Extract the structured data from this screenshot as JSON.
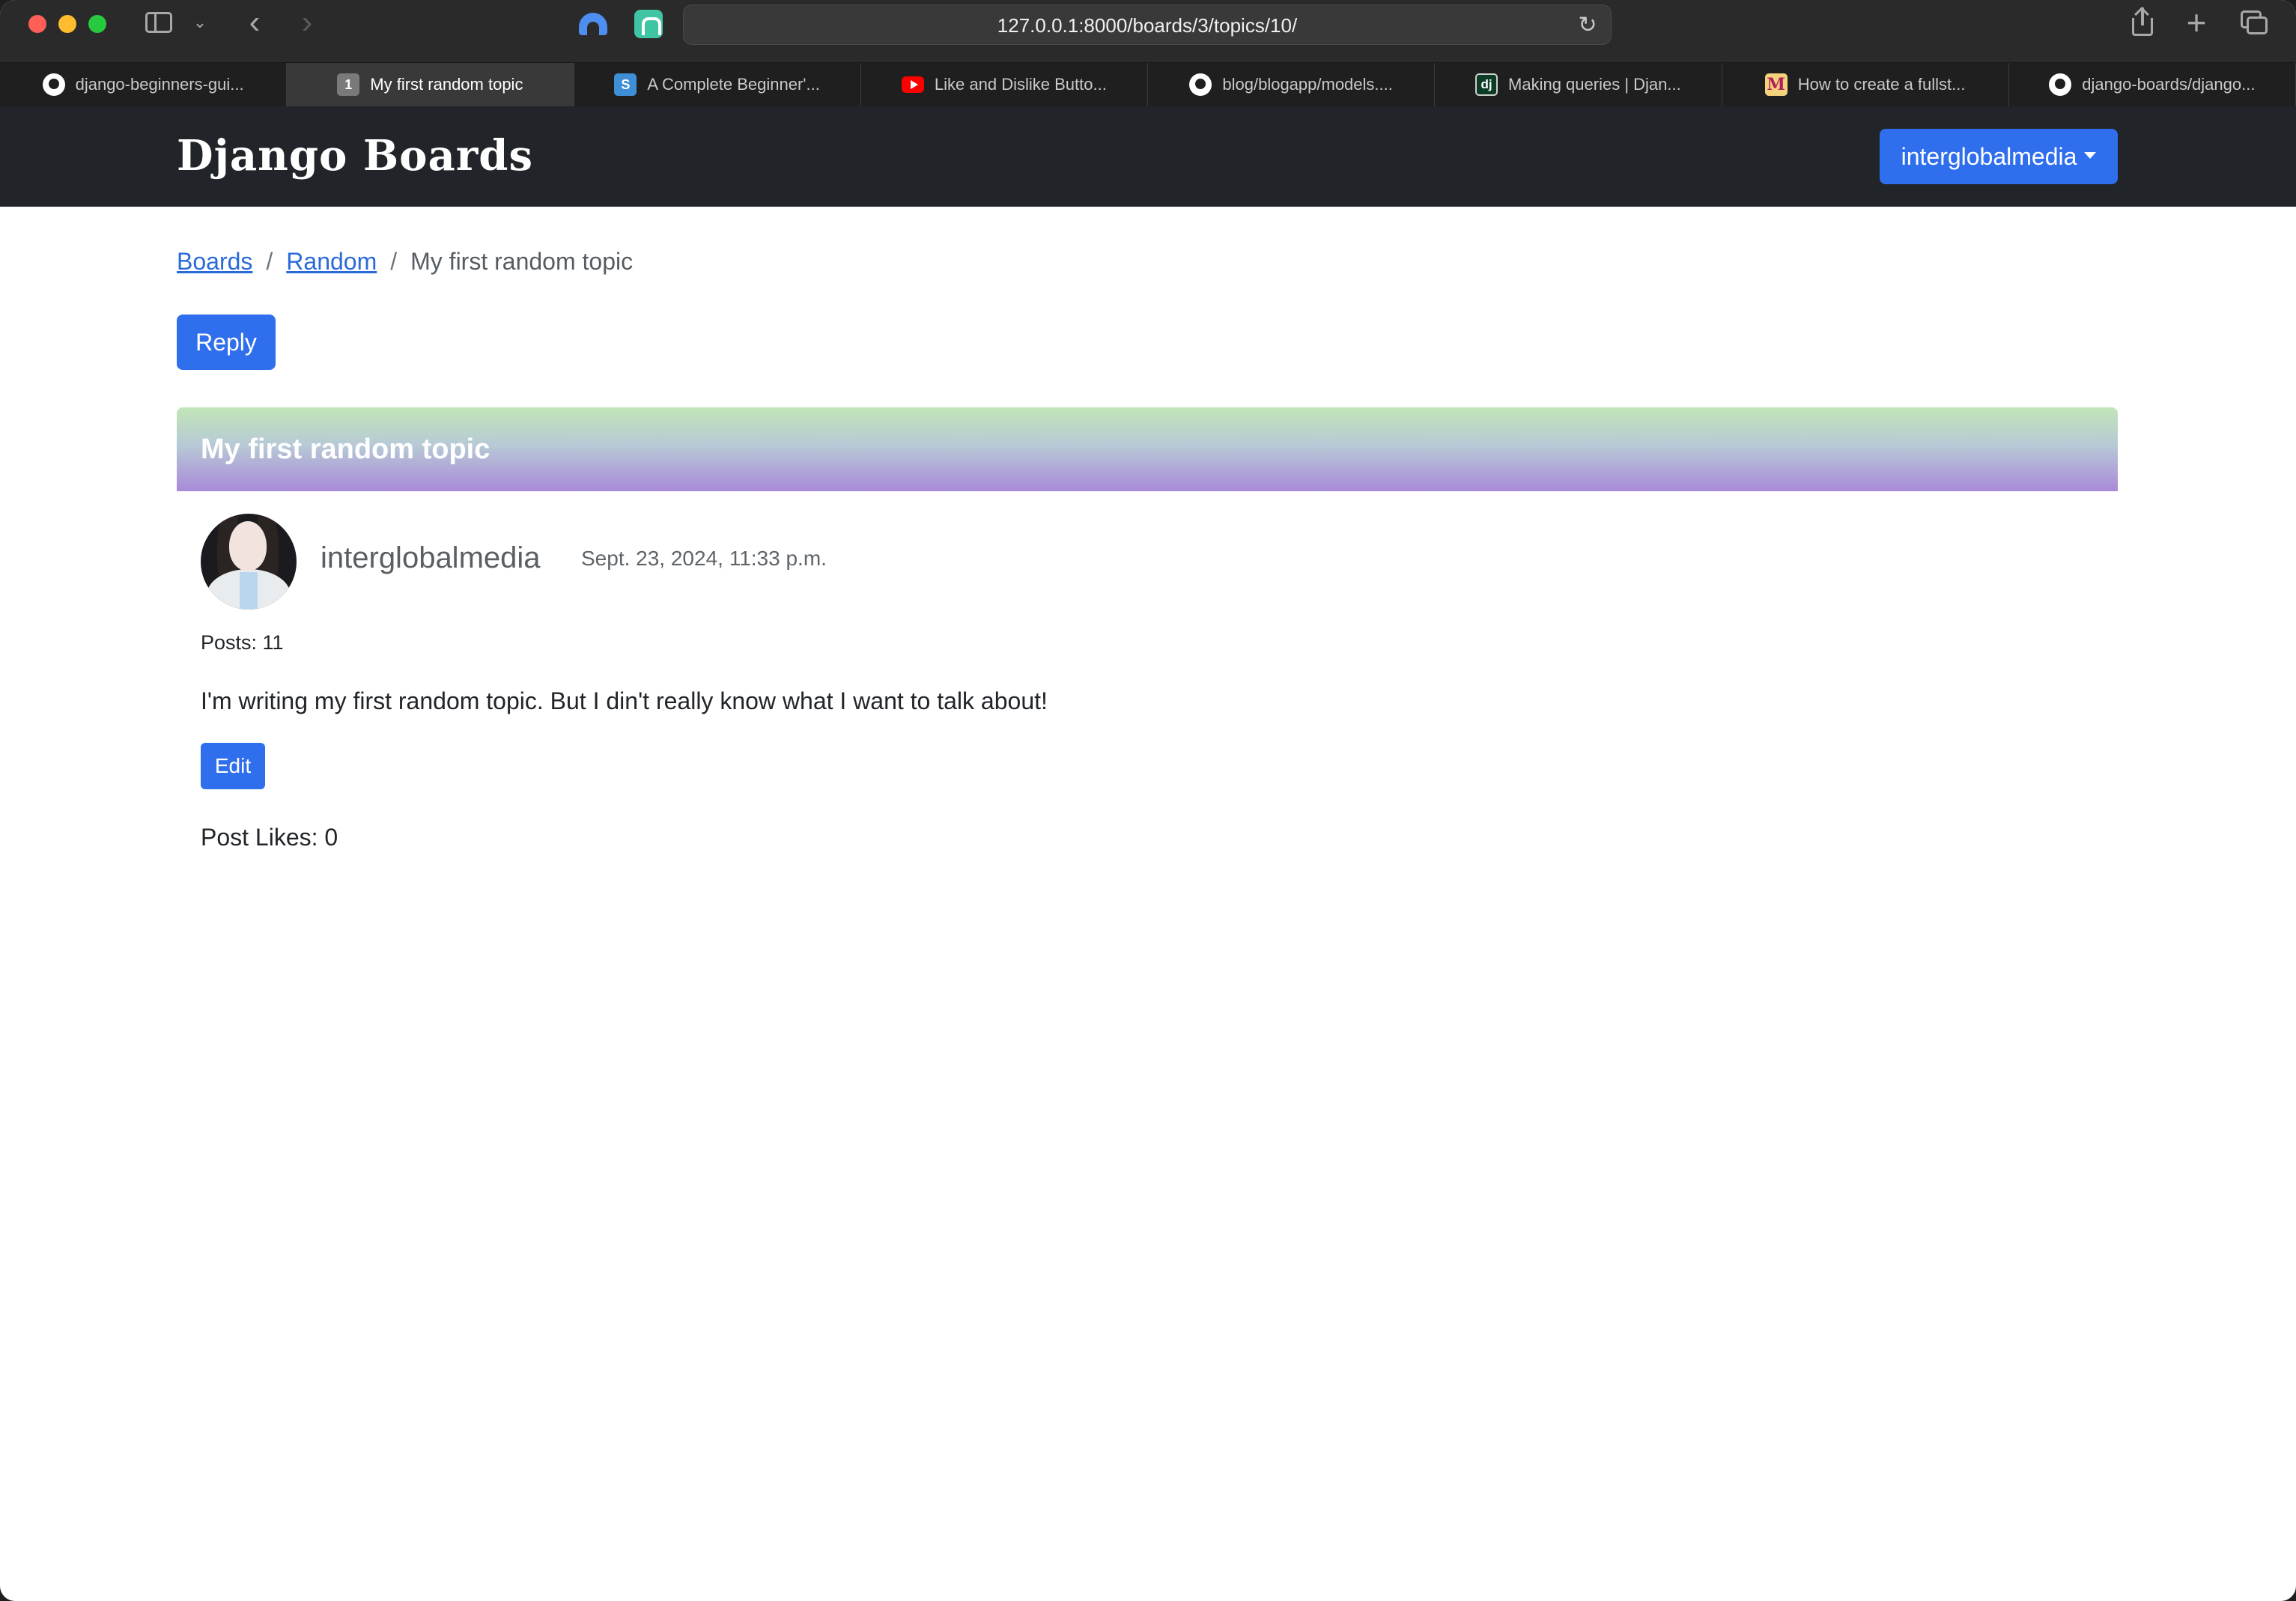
{
  "browser": {
    "url": "127.0.0.1:8000/boards/3/topics/10/",
    "tabs": [
      {
        "label": "django-beginners-gui...",
        "favicon": "github-icon",
        "active": false
      },
      {
        "label": "My first random topic",
        "favicon": "number-icon",
        "favicon_text": "1",
        "active": true
      },
      {
        "label": "A Complete Beginner'...",
        "favicon": "s-icon",
        "favicon_text": "S",
        "active": false
      },
      {
        "label": "Like and Dislike Butto...",
        "favicon": "youtube-icon",
        "active": false
      },
      {
        "label": "blog/blogapp/models....",
        "favicon": "github-icon",
        "active": false
      },
      {
        "label": "Making queries | Djan...",
        "favicon": "django-icon",
        "favicon_text": "dj",
        "active": false
      },
      {
        "label": "How to create a fullst...",
        "favicon": "medium-icon",
        "favicon_text": "M",
        "active": false
      },
      {
        "label": "django-boards/django...",
        "favicon": "github-icon",
        "active": false
      }
    ]
  },
  "site": {
    "brand": "Django Boards",
    "user_menu_label": "interglobalmedia"
  },
  "breadcrumb": {
    "items": [
      {
        "label": "Boards"
      },
      {
        "label": "Random"
      }
    ],
    "separator": "/",
    "current": "My first random topic"
  },
  "actions": {
    "reply_label": "Reply"
  },
  "topic": {
    "title": "My first random topic"
  },
  "post": {
    "author": "interglobalmedia",
    "date": "Sept. 23, 2024, 11:33 p.m.",
    "posts_count": "Posts: 11",
    "body": "I'm writing my first random topic. But I din't really know what I want to talk about!",
    "edit_label": "Edit",
    "likes": "Post Likes: 0"
  },
  "colors": {
    "navbar_bg": "#212529",
    "primary": "#2f6fed",
    "link": "#2a6ad8",
    "header_gradient_top": "#c2e6b8",
    "header_gradient_bottom": "#a98ad8"
  }
}
